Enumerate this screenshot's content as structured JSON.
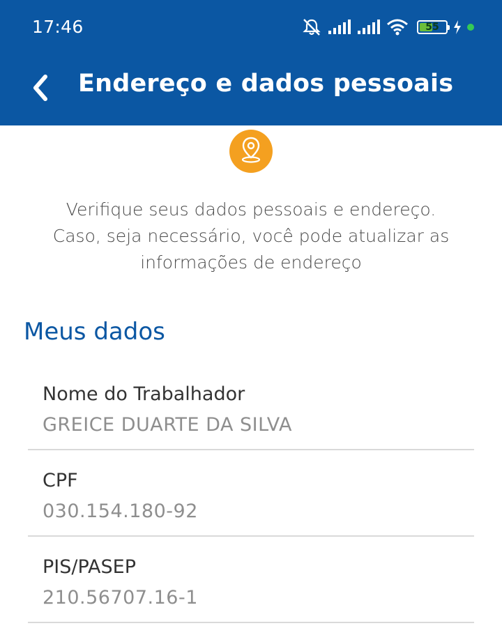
{
  "status_bar": {
    "time": "17:46",
    "battery_level": "55",
    "icons": [
      "muted-bell-icon",
      "signal-icon",
      "signal-icon",
      "wifi-icon",
      "battery-icon",
      "charging-icon",
      "status-dot-icon"
    ]
  },
  "app_bar": {
    "title": "Endereço e dados pessoais",
    "back_icon": "chevron-left-icon"
  },
  "hero": {
    "icon": "location-pin-icon",
    "icon_color": "#f4a020"
  },
  "intro": {
    "line1": "Verifique seus dados pessoais e endereço.",
    "line2": "Caso, seja necessário, você pode atualizar as",
    "line3": "informações de endereço"
  },
  "section": {
    "title": "Meus dados"
  },
  "fields": [
    {
      "label": "Nome do Trabalhador",
      "value": "GREICE DUARTE DA SILVA"
    },
    {
      "label": "CPF",
      "value": "030.154.180-92"
    },
    {
      "label": "PIS/PASEP",
      "value": "210.56707.16-1"
    }
  ],
  "colors": {
    "brand_blue": "#0b57a3",
    "accent_orange": "#f4a020",
    "label_text": "#333333",
    "value_text": "#8e8e8e",
    "divider": "#d9d9d9"
  }
}
